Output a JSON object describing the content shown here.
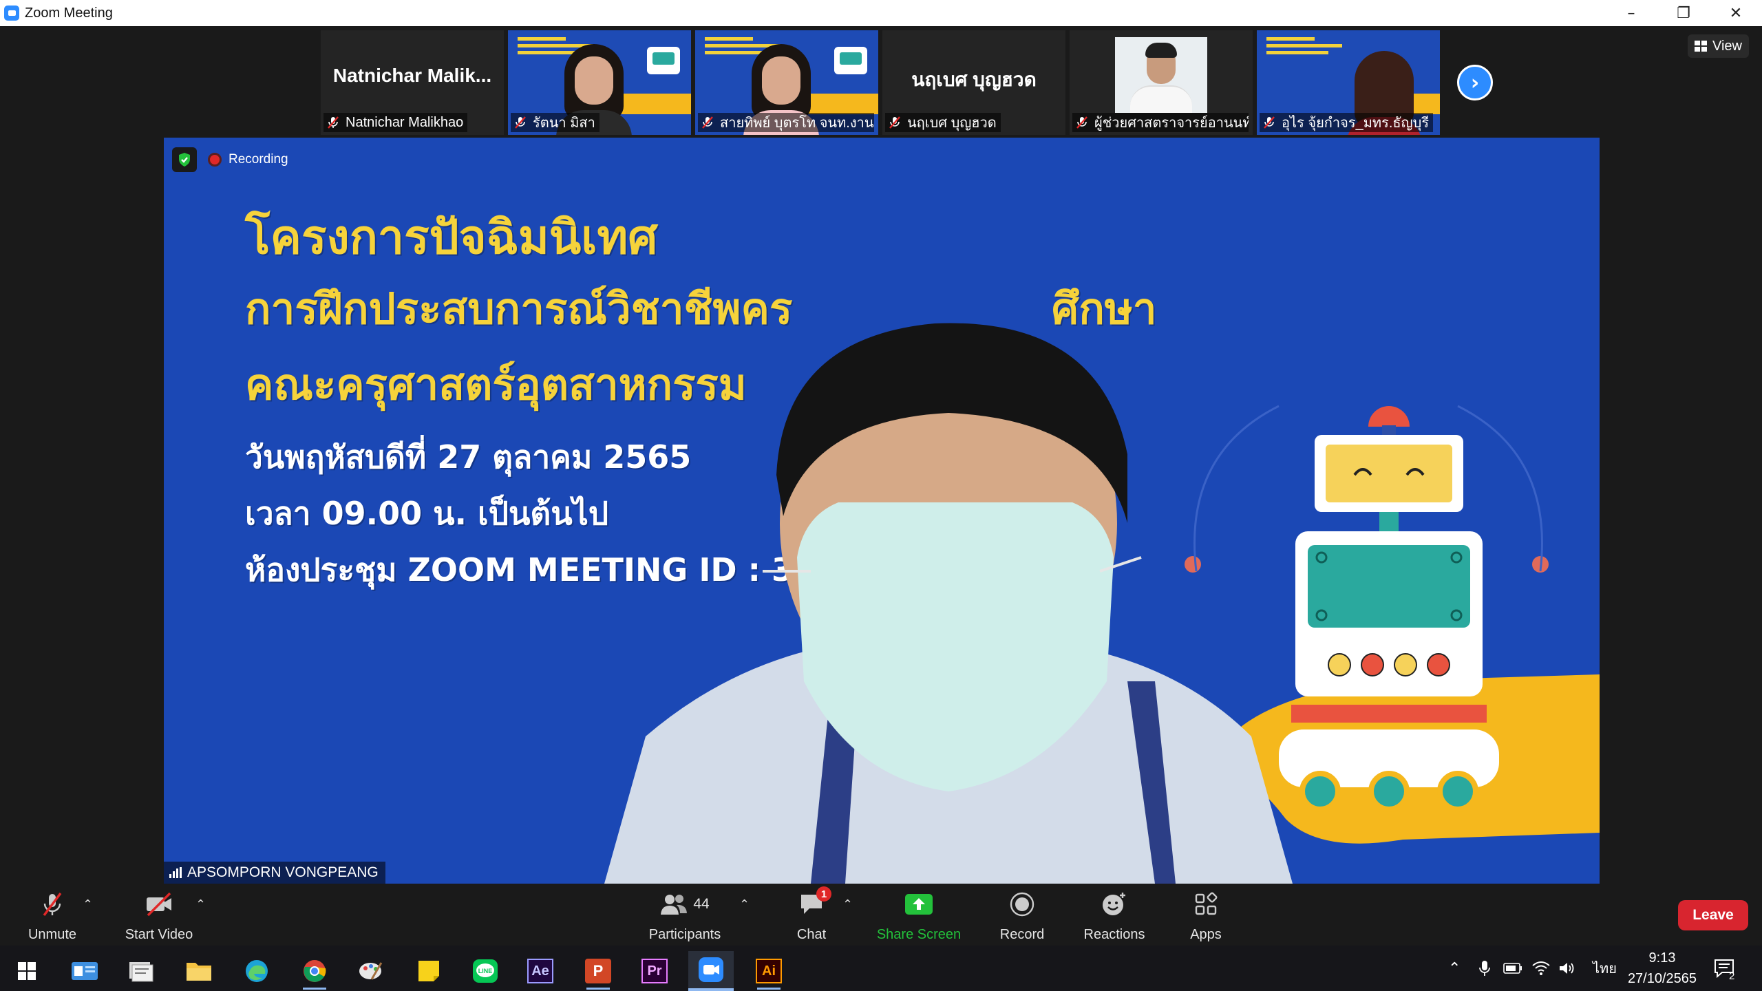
{
  "window": {
    "title": "Zoom Meeting"
  },
  "view": {
    "label": "View"
  },
  "participants_strip": [
    {
      "type": "name",
      "display": "Natnichar  Malik...",
      "label": "Natnichar Malikhao"
    },
    {
      "type": "video",
      "label": "รัตนา  มิสา"
    },
    {
      "type": "video",
      "label": "สายทิพย์ บุตรโท จนท.งาน..."
    },
    {
      "type": "name",
      "display": "นฤเบศ บุญฮวด",
      "label": "นฤเบศ บุญฮวด"
    },
    {
      "type": "photo",
      "label": "ผู้ช่วยศาสตราจารย์อานนท์..."
    },
    {
      "type": "video",
      "label": "อุไร จุ้ยกำจร_มทร.ธัญบุรี"
    }
  ],
  "main": {
    "recording_label": "Recording",
    "speaker": "APSOMPORN VONGPEANG",
    "slide": {
      "line1": "โครงการปัจฉิมนิเทศ",
      "line2": "การฝึกประสบการณ์วิชาชีพคร",
      "line2b": "ศึกษา",
      "line3": "คณะครุศาสตร์อุตสาหกรรม",
      "date": "วันพฤหัสบดีที่ 27 ตุลาคม 2565",
      "time": "เวลา 09.00 น. เป็นต้นไป",
      "room": "ห้องประชุม ZOOM MEETING ID : 3101"
    }
  },
  "toolbar": {
    "unmute": "Unmute",
    "start_video": "Start Video",
    "participants": "Participants",
    "participants_count": "44",
    "chat": "Chat",
    "chat_badge": "1",
    "share_screen": "Share Screen",
    "record": "Record",
    "reactions": "Reactions",
    "apps": "Apps",
    "leave": "Leave"
  },
  "taskbar": {
    "apps": [
      "windows-start",
      "outlook",
      "file-manager",
      "file-explorer",
      "edge",
      "chrome",
      "paint-app",
      "sticky-notes",
      "line",
      "after-effects",
      "powerpoint",
      "premiere",
      "zoom",
      "illustrator"
    ],
    "ae": "Ae",
    "pr": "Pr",
    "ai": "Ai",
    "p": "P",
    "lang": "ไทย",
    "time": "9:13",
    "date": "27/10/2565",
    "notifications": "2"
  },
  "colors": {
    "zoom_blue": "#2d8cff",
    "leave_red": "#d8252f",
    "share_green": "#23c13b",
    "slide_yellow": "#f6d33b",
    "slide_blue": "#1b48b5"
  }
}
